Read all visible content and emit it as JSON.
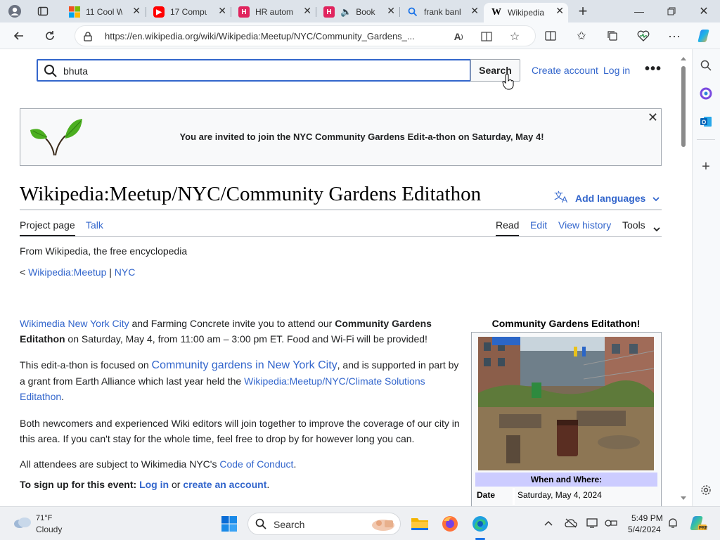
{
  "browser": {
    "tabs": [
      {
        "label": "11 Cool W",
        "icon": "microsoft-icon"
      },
      {
        "label": "17 Compu",
        "icon": "youtube-icon"
      },
      {
        "label": "HR autom",
        "icon": "app-h-icon"
      },
      {
        "label": "Book",
        "icon": "app-h-audio-icon"
      },
      {
        "label": "frank banl",
        "icon": "search-icon"
      },
      {
        "label": "Wikipedia",
        "icon": "wikipedia-icon",
        "active": true
      }
    ],
    "url": "https://en.wikipedia.org/wiki/Wikipedia:Meetup/NYC/Community_Gardens_..."
  },
  "header": {
    "search_value": "bhuta",
    "search_button": "Search",
    "create_account": "Create account",
    "log_in": "Log in"
  },
  "banner": {
    "text": "You are invited to join the NYC Community Gardens Edit-a-thon on Saturday, May 4!"
  },
  "article": {
    "title": "Wikipedia:Meetup/NYC/Community Gardens Editathon",
    "add_languages": "Add languages",
    "tabs_left": [
      "Project page",
      "Talk"
    ],
    "tabs_right": [
      "Read",
      "Edit",
      "View history",
      "Tools"
    ],
    "tagline": "From Wikipedia, the free encyclopedia",
    "breadcrumb_prefix": "< ",
    "breadcrumb_meetup": "Wikipedia:Meetup",
    "breadcrumb_sep": " | ",
    "breadcrumb_nyc": "NYC",
    "p1": {
      "link": "Wikimedia New York City",
      "t1": " and Farming Concrete invite you to attend our ",
      "bold": "Community Gardens Editathon",
      "t2": " on Saturday, May 4, from 11:00 am – 3:00 pm ET. Food and Wi-Fi will be provided!"
    },
    "p2": {
      "t1": "This edit-a-thon is focused on ",
      "link1": "Community gardens in New York City",
      "t2": ", and is supported in part by a grant from Earth Alliance which last year held the ",
      "link2": "Wikipedia:Meetup/NYC/Climate Solutions Editathon",
      "t3": "."
    },
    "p3": "Both newcomers and experienced Wiki editors will join together to improve the coverage of our city in this area. If you can't stay for the whole time, feel free to drop by for however long you can.",
    "p4": {
      "t1": "All attendees are subject to Wikimedia NYC's ",
      "link": "Code of Conduct",
      "t2": "."
    },
    "p5": {
      "bold": "To sign up for this event: ",
      "link1": "Log in",
      "t1": " or ",
      "link2": "create an account",
      "t2": "."
    }
  },
  "infobox": {
    "title": "Community Gardens Editathon!",
    "header": "When and Where:",
    "row_label": "Date",
    "row_value": "Saturday, May 4, 2024"
  },
  "taskbar": {
    "weather_temp": "71°F",
    "weather_desc": "Cloudy",
    "search_label": "Search",
    "time": "5:49 PM",
    "date": "5/4/2024"
  },
  "colors": {
    "link": "#3366cc",
    "infobox_header": "#ccccff",
    "leaf_green": "#4caf20"
  }
}
